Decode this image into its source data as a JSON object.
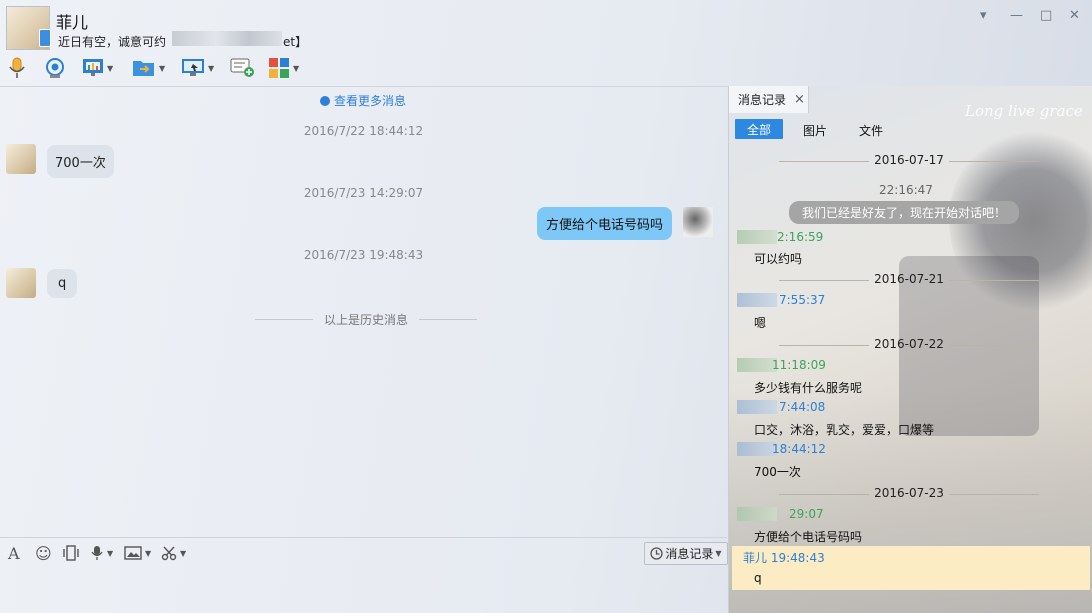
{
  "header": {
    "contact_name": "菲儿",
    "status_text": "近日有空，诚意可约",
    "status_tail": "et】",
    "toolbar_icons": [
      "microphone-icon",
      "camera-icon",
      "screen-share-icon",
      "file-transfer-icon",
      "remote-desktop-icon",
      "new-chat-icon",
      "apps-grid-icon"
    ],
    "window_controls": {
      "dropdown": "▾",
      "minimize": "—",
      "maximize": "□",
      "close": "✕"
    }
  },
  "chat": {
    "more_messages": "查看更多消息",
    "messages": [
      {
        "time": "2016/7/22 18:44:12",
        "side": "left",
        "text": "700一次"
      },
      {
        "time": "2016/7/23 14:29:07",
        "side": "right",
        "text": "方便给个电话号码吗"
      },
      {
        "time": "2016/7/23 19:48:43",
        "side": "left",
        "text": "q"
      }
    ],
    "history_divider": "以上是历史消息"
  },
  "input_toolbar": {
    "font_glyph": "A",
    "emoji_glyph": "☺",
    "history_button": "消息记录"
  },
  "history_panel": {
    "tab_label": "消息记录",
    "tab_close": "×",
    "filters": {
      "all": "全部",
      "images": "图片",
      "files": "文件"
    },
    "entries": {
      "d1": "2016-07-17",
      "t1": "22:16:47",
      "sys": "我们已经是好友了，现在开始对话吧！",
      "t2": "2:16:59",
      "m2": "可以约吗",
      "d2": "2016-07-21",
      "t3": "7:55:37",
      "m3": "嗯",
      "d3": "2016-07-22",
      "t4": "11:18:09",
      "m4": "多少钱有什么服务呢",
      "t5": "7:44:08",
      "m5": "口交，沐浴，乳交，爱爱，口爆等",
      "t6": "18:44:12",
      "m6": "700一次",
      "d4": "2016-07-23",
      "t7": "29:07",
      "m7": "方便给个电话号码吗",
      "t8": "菲儿 19:48:43",
      "m8": "q"
    },
    "background_script": "Long live grace"
  }
}
